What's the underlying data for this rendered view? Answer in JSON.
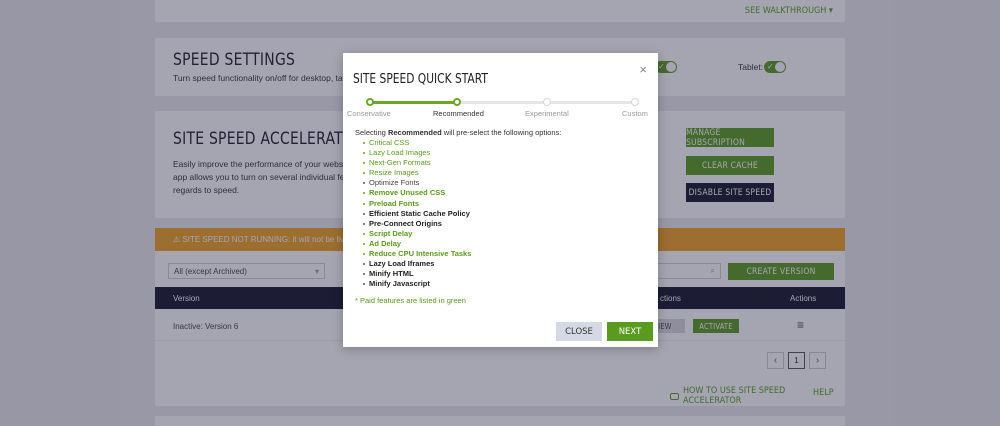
{
  "top": {
    "walkthrough_label": "SEE WALKTHROUGH ▾"
  },
  "speed_settings": {
    "title": "SPEED SETTINGS",
    "subtitle": "Turn speed functionality on/off for desktop, tablet",
    "tablet_label": "Tablet:",
    "toggle_check": "✓"
  },
  "accelerator": {
    "title": "SITE SPEED ACCELERATOR",
    "desc_line1": "Easily improve the performance of your website b",
    "desc_line2": "app allows you to turn on several individual featu",
    "desc_line3": "regards to speed.",
    "manage_button": "MANAGE SUBSCRIPTION",
    "clear_button": "CLEAR CACHE",
    "disable_button": "DISABLE SITE SPEED"
  },
  "alert": {
    "text": "⚠ SITE SPEED NOT RUNNING: it will not be live u"
  },
  "filters": {
    "archive_select": "All (except Archived)",
    "create_button": "CREATE VERSION"
  },
  "table": {
    "col_version": "Version",
    "col_actions_partial": "ctions",
    "col_actions": "Actions",
    "row_version": "Inactive: Version 6",
    "view_button": "VIEW",
    "activate_button": "ACTIVATE",
    "menu_icon": "≡"
  },
  "pagination": {
    "prev": "‹",
    "page": "1",
    "next": "›"
  },
  "footer": {
    "howto_label": "HOW TO USE SITE SPEED ACCELERATOR",
    "help_label": "HELP"
  },
  "modal": {
    "title": "SITE SPEED QUICK START",
    "close_icon": "×",
    "steps": [
      "Conservative",
      "Recommended",
      "Experimental",
      "Custom"
    ],
    "intro_before": "Selecting ",
    "intro_bold": "Recommended",
    "intro_after": " will pre-select the following options:",
    "options": [
      {
        "label": "Critical CSS",
        "paid": true,
        "bold": false
      },
      {
        "label": "Lazy Load Images",
        "paid": true,
        "bold": false
      },
      {
        "label": "Next-Gen Formats",
        "paid": true,
        "bold": false
      },
      {
        "label": "Resize Images",
        "paid": true,
        "bold": false
      },
      {
        "label": "Optimize Fonts",
        "paid": false,
        "bold": false
      },
      {
        "label": "Remove Unused CSS",
        "paid": true,
        "bold": true
      },
      {
        "label": "Preload Fonts",
        "paid": true,
        "bold": true
      },
      {
        "label": "Efficient Static Cache Policy",
        "paid": false,
        "bold": true
      },
      {
        "label": "Pre-Connect Origins",
        "paid": false,
        "bold": true
      },
      {
        "label": "Script Delay",
        "paid": true,
        "bold": true
      },
      {
        "label": "Ad Delay",
        "paid": true,
        "bold": true
      },
      {
        "label": "Reduce CPU Intensive Tasks",
        "paid": true,
        "bold": true
      },
      {
        "label": "Lazy Load Iframes",
        "paid": false,
        "bold": true
      },
      {
        "label": "Minify HTML",
        "paid": false,
        "bold": true
      },
      {
        "label": "Minify Javascript",
        "paid": false,
        "bold": true
      }
    ],
    "note": "* Paid features are listed in green",
    "close_button": "CLOSE",
    "next_button": "NEXT"
  },
  "colors": {
    "accent_green": "#5a9a1e",
    "dark_navy": "#141428",
    "alert_orange": "#f0a020"
  }
}
